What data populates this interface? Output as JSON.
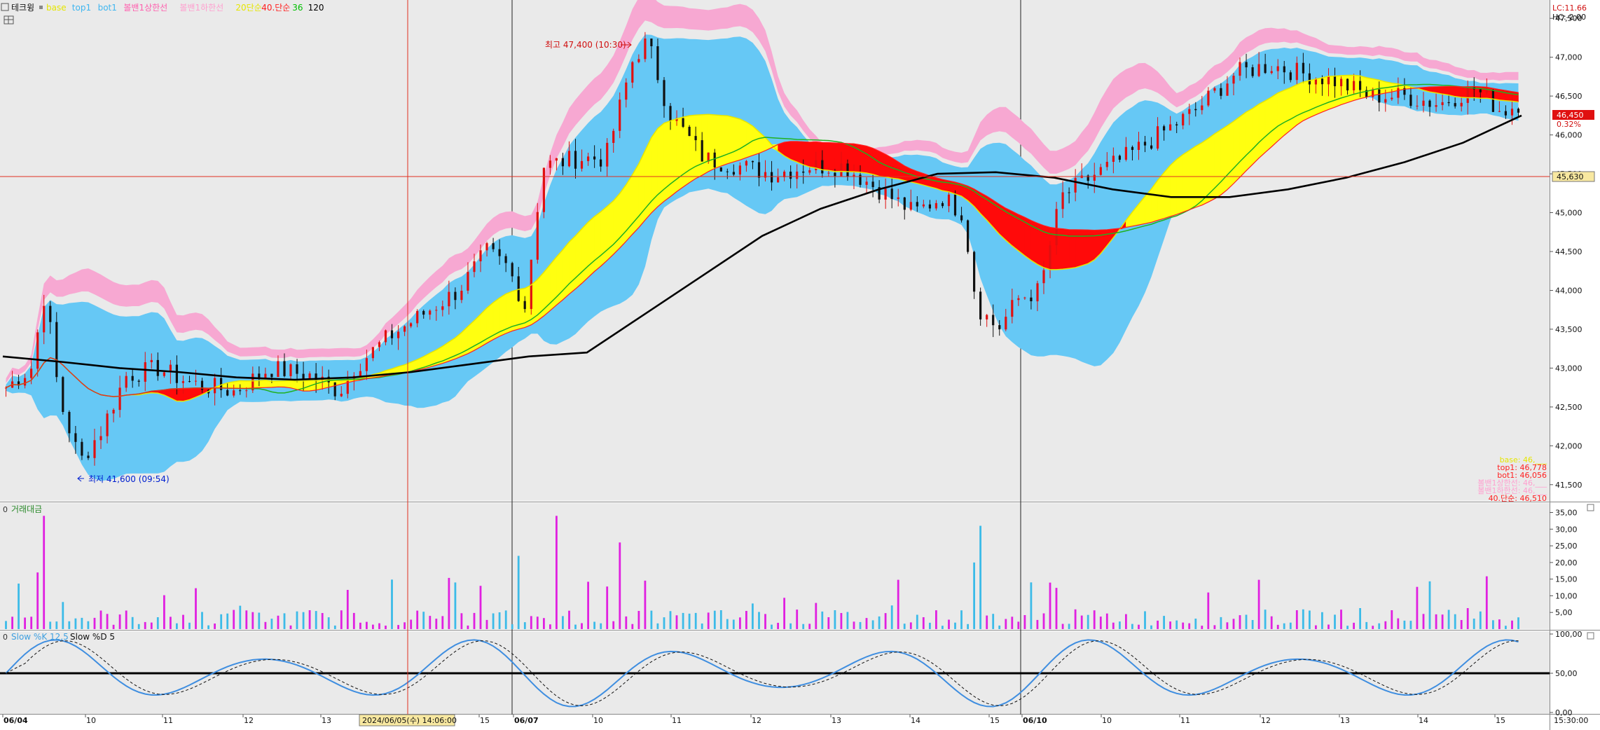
{
  "legend": {
    "chart_name": "테크윙",
    "items": [
      {
        "label": "base",
        "color": "#e6e600"
      },
      {
        "label": "top1",
        "color": "#3fb6f0"
      },
      {
        "label": "bot1",
        "color": "#3fb6f0"
      },
      {
        "label": "볼밴1상한선",
        "color": "#ff5fae"
      },
      {
        "label": "볼밴1하한선",
        "color": "#ff9fcf"
      },
      {
        "label": "20단순",
        "color": "#e6e600"
      },
      {
        "label": "40.단순",
        "color": "#ff2020"
      },
      {
        "label": "36",
        "color": "#00c000"
      },
      {
        "label": "120",
        "color": "#000000"
      }
    ]
  },
  "price_axis": {
    "ticks": [
      "47,500",
      "47,000",
      "46,500",
      "46,000",
      "45,500",
      "45,000",
      "44,500",
      "44,000",
      "43,500",
      "43,000",
      "42,500",
      "42,000",
      "41,500"
    ],
    "lc_label": "LC:11.66",
    "hc_label": "HC:-2.00",
    "current_price": "46,450",
    "change_pct": "0.32%",
    "crosshair_price": "45,630"
  },
  "annotations": {
    "high_label": "최고 47,400 (10:30)",
    "low_label": "최저 41,600 (09:54)"
  },
  "value_box": [
    {
      "label": "base: 46,___",
      "color": "#e6e600"
    },
    {
      "label": "top1: 46,778",
      "color": "#ff2020"
    },
    {
      "label": "bot1: 46,056",
      "color": "#ff2020"
    },
    {
      "label": "볼밴1상한선: 46,___",
      "color": "#ff9fcf"
    },
    {
      "label": "볼밴1하한선: 46,___",
      "color": "#ff9fcf"
    },
    {
      "label": "40.단순: 46,510",
      "color": "#ff2020"
    }
  ],
  "volume_pane": {
    "title": "거래대금",
    "ticks": [
      "35,00",
      "30,00",
      "25,00",
      "20,00",
      "15,00",
      "10,00",
      "5,00"
    ]
  },
  "stoch_pane": {
    "title_k": "Slow %K 12,5",
    "title_d": "Slow %D 5",
    "ticks": [
      "100,00",
      "50,00",
      "0,00"
    ]
  },
  "x_axis": {
    "labels": [
      "06/04",
      "10",
      "11",
      "12",
      "13",
      "14",
      "15",
      "06/07",
      "10",
      "11",
      "12",
      "13",
      "14",
      "15",
      "06/10",
      "10",
      "11",
      "12",
      "13",
      "14",
      "15"
    ],
    "crosshair_time": "2024/06/05(수) 14:06:00",
    "last_time": "15:30:00"
  },
  "chart_data": {
    "type": "candlestick",
    "title": "테크윙",
    "ylim": [
      41300,
      47700
    ],
    "high": 47400,
    "low": 41600,
    "close": 46450,
    "series": [
      {
        "name": "120",
        "values": [
          43150,
          43080,
          43000,
          42950,
          42880,
          42850,
          42880,
          42950,
          43050,
          43150,
          43200,
          43700,
          44200,
          44700,
          45050,
          45300,
          45500,
          45520,
          45450,
          45300,
          45200,
          45200,
          45300,
          45450,
          45650,
          45900,
          46250
        ]
      }
    ]
  }
}
